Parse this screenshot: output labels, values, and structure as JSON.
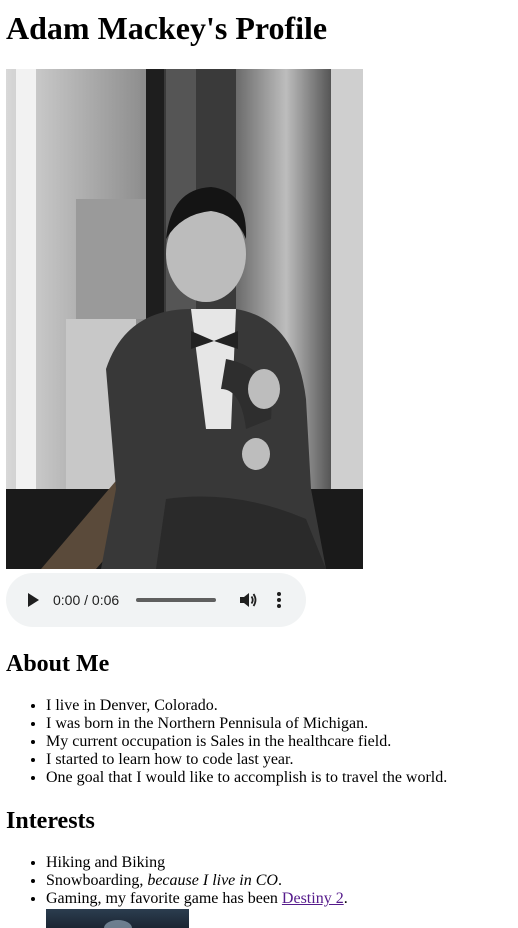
{
  "page": {
    "title": "Adam Mackey's Profile"
  },
  "portrait": {
    "alt": "Black and white portrait of Adam Mackey sitting by a window in a suit and bow tie"
  },
  "audio": {
    "time": "0:00 / 0:06",
    "progress": 0
  },
  "about": {
    "heading": "About Me",
    "items": [
      "I live in Denver, Colorado.",
      "I was born in the Northern Pennisula of Michigan.",
      "My current occupation is Sales in the healthcare field.",
      "I started to learn how to code last year.",
      "One goal that I would like to accomplish is to travel the world."
    ]
  },
  "interests": {
    "heading": "Interests",
    "item1": "Hiking and Biking",
    "item2_text": "Snowboarding, ",
    "item2_em": "because I live in CO",
    "item2_end": ".",
    "item3_text": "Gaming, my favorite game has been ",
    "item3_link": "Destiny 2",
    "item3_end": "."
  },
  "colors": {
    "link_visited": "#551a8b",
    "audio_bg": "#f1f3f4"
  }
}
